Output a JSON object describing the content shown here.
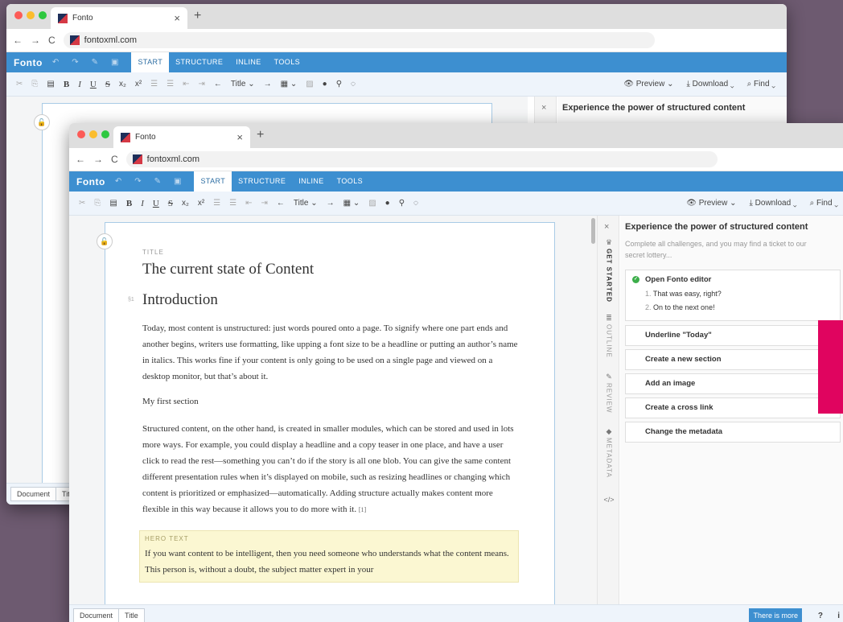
{
  "browser": {
    "tab_title": "Fonto",
    "url": "fontoxml.com",
    "tab_close": "×",
    "new_tab": "+",
    "back": "←",
    "forward": "→",
    "reload": "C"
  },
  "menubar": {
    "brand": "Fonto",
    "tabs": [
      "START",
      "STRUCTURE",
      "INLINE",
      "TOOLS"
    ]
  },
  "toolbar": {
    "bold": "B",
    "italic": "I",
    "underline": "U",
    "strike": "S",
    "subscript": "x₂",
    "superscript": "x²",
    "title_dropdown": "Title",
    "preview": "Preview",
    "download": "Download",
    "find": "Find"
  },
  "document": {
    "title_label": "TITLE",
    "title": "The current state of Content",
    "heading_num": "§1",
    "heading": "Introduction",
    "para1": "Today, most content is unstructured: just words poured onto a page. To signify where one part ends and another begins, writers use formatting, like upping a font size to be a headline or putting an author’s name in italics. This works fine if your content is only going to be used on a single page and viewed on a desktop monitor, but that’s about it.",
    "section_title": "My first section",
    "para2": "Structured content, on the other hand, is created in smaller modules, which can be stored and used in lots more ways. For example, you could display a headline and a copy teaser in one place, and have a user click to read the rest—something you can’t do if the story is all one blob. You can give the same content different presentation rules when it’s displayed on mobile, such as resizing headlines or changing which content is prioritized or emphasized—automatically. Adding structure actually makes content more flexible in this way because it allows you to do more with it.",
    "para2_ref": "[1]",
    "hero_label": "HERO TEXT",
    "hero_text": "If you want content to be intelligent, then you need someone who understands what the content means. This person is, without a doubt, the subject matter expert in your"
  },
  "sidebar": {
    "close": "×",
    "tabs": [
      "GET STARTED",
      "OUTLINE",
      "REVIEW",
      "METADATA"
    ],
    "code_icon": "</>",
    "title": "Experience the power of structured content",
    "subtitle": "Complete all challenges, and you may find a ticket to our secret lottery...",
    "first_challenge": "Open Fonto editor",
    "first_steps": [
      "That was easy, right?",
      "On to the next one!"
    ],
    "challenges": [
      "Underline \"Today\"",
      "Create a new section",
      "Add an image",
      "Create a cross link",
      "Change the metadata"
    ]
  },
  "statusbar": {
    "breadcrumb": [
      "Document",
      "Title"
    ],
    "back_breadcrumb": [
      "Document",
      "Tit"
    ],
    "more": "There is more",
    "help": "?",
    "info": "i"
  },
  "colors": {
    "accent": "#3d8fd0",
    "background": "#6d5a70",
    "hero": "#fbf7d2",
    "pink": "#e0045f"
  }
}
